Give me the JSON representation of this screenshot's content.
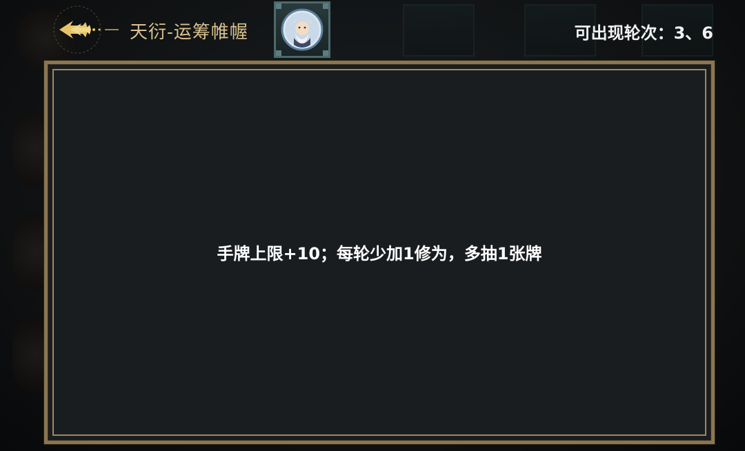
{
  "header": {
    "title": "天衍-运筹帷幄",
    "rounds_text": "可出现轮次：3、6",
    "back_icon": "arrow-back-icon",
    "portrait_icon": "sage-portrait-icon"
  },
  "panel": {
    "description": "手牌上限+10；每轮少加1修为，多抽1张牌"
  },
  "colors": {
    "accent_gold": "#d9c28e",
    "frame_gold": "#8b7651",
    "panel_bg": "#1a1d20",
    "text_white": "#ffffff"
  }
}
